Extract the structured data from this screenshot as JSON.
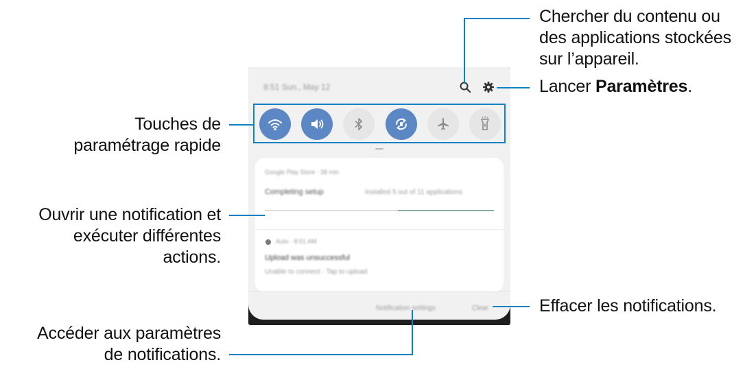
{
  "callouts": {
    "search": [
      "Chercher du contenu ou",
      "des applications stockées",
      "sur l’appareil."
    ],
    "settings_prefix": "Lancer ",
    "settings_bold": "Paramètres",
    "settings_suffix": ".",
    "quick_settings": [
      "Touches de",
      "paramétrage rapide"
    ],
    "notification": [
      "Ouvrir une notification et",
      "exécuter différentes",
      "actions."
    ],
    "clear": "Effacer les notifications.",
    "notif_settings": [
      "Accéder aux paramètres",
      "de notifications."
    ]
  },
  "phone": {
    "status_text": "8:51  Sun., May 12",
    "quick_buttons": [
      {
        "name": "wifi-toggle",
        "icon": "wifi-icon",
        "on": true
      },
      {
        "name": "sound-toggle",
        "icon": "speaker-icon",
        "on": true
      },
      {
        "name": "bluetooth-toggle",
        "icon": "bluetooth-icon",
        "on": false
      },
      {
        "name": "auto-rotate-toggle",
        "icon": "rotate-icon",
        "on": true
      },
      {
        "name": "airplane-toggle",
        "icon": "airplane-icon",
        "on": false
      },
      {
        "name": "flashlight-toggle",
        "icon": "flashlight-icon",
        "on": false
      }
    ],
    "notification1": {
      "app": "Google Play Store · 38 min",
      "title": "Completing setup",
      "detail": "Installed 5 out of 11 applications",
      "progress": 0.42
    },
    "notification2": {
      "app": "Auto · 8:51 AM",
      "title": "Upload was unsuccessful",
      "body": "Unable to connect · Tap to upload"
    },
    "footer": {
      "settings_label": "Notification settings",
      "clear_label": "Clear"
    }
  },
  "colors": {
    "accent": "#0f80c2",
    "toggle_on": "#5b87c4",
    "toggle_off": "#e6e6e6",
    "panel": "#f1f1f1"
  }
}
